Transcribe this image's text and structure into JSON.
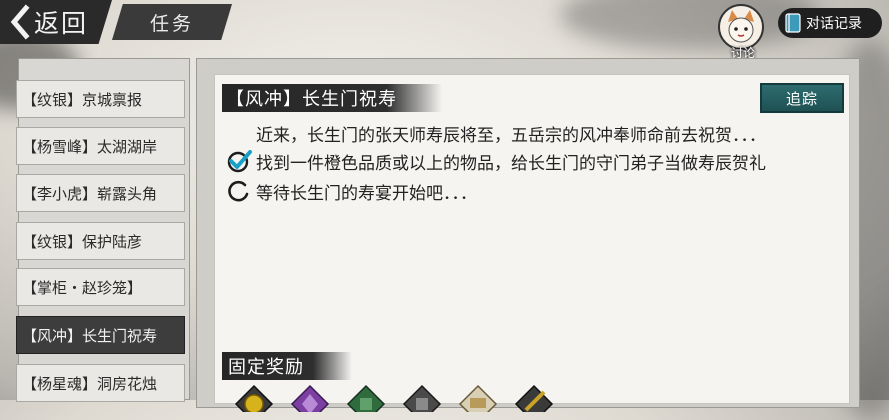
{
  "header": {
    "back_label": "返回",
    "title": "任务",
    "discuss_label": "讨论",
    "dialog_log_label": "对话记录"
  },
  "quest_list": [
    {
      "label": "【纹银】京城禀报",
      "active": false
    },
    {
      "label": "【杨雪峰】太湖湖岸",
      "active": false
    },
    {
      "label": "【李小虎】崭露头角",
      "active": false
    },
    {
      "label": "【纹银】保护陆彦",
      "active": false
    },
    {
      "label": "【掌柜・赵珍笼】",
      "active": false
    },
    {
      "label": "【风冲】长生门祝寿",
      "active": true
    },
    {
      "label": "【杨星魂】洞房花烛",
      "active": false
    }
  ],
  "quest": {
    "title": "【风冲】长生门祝寿",
    "track_label": "追踪",
    "description": "近来，长生门的张天师寿辰将至，五岳宗的风冲奉师命前去祝贺．．．",
    "tasks": [
      {
        "text": "找到一件橙色品质或以上的物品，给长生门的守门弟子当做寿辰贺礼",
        "status": "done",
        "icon": "checkmark-icon"
      },
      {
        "text": "等待长生门的寿宴开始吧．．．",
        "status": "pending",
        "icon": "progress-ring-icon"
      }
    ]
  },
  "rewards": {
    "title": "固定奖励",
    "items": [
      {
        "icon": "gold-coin-icon",
        "color": "#d6b21c"
      },
      {
        "icon": "purple-item-icon",
        "color": "#7a3fa0"
      },
      {
        "icon": "green-item-icon",
        "color": "#2f6b3c"
      },
      {
        "icon": "gray-item-icon",
        "color": "#4a4a4a"
      },
      {
        "icon": "scroll-item-icon",
        "color": "#b89a5a"
      },
      {
        "icon": "brush-item-icon",
        "color": "#c9a227"
      }
    ]
  },
  "colors": {
    "track_button": "#2a6366",
    "active_item": "#3d3d3d",
    "check": "#1aa0c8"
  }
}
